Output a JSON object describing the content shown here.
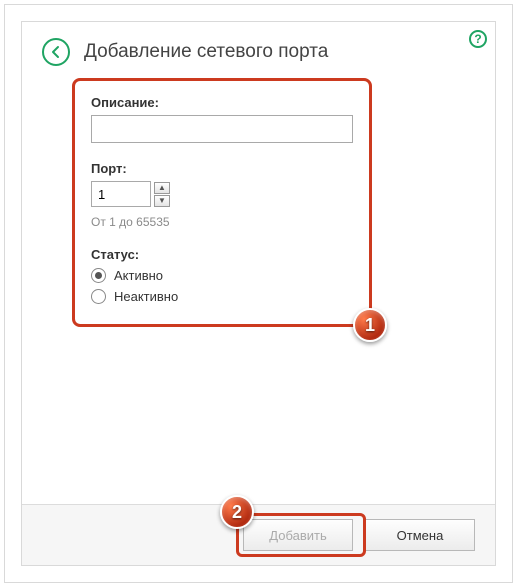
{
  "header": {
    "title": "Добавление сетевого порта"
  },
  "form": {
    "description_label": "Описание:",
    "description_value": "",
    "port_label": "Порт:",
    "port_value": "1",
    "port_hint": "От 1 до 65535",
    "status_label": "Статус:",
    "status_options": {
      "active": "Активно",
      "inactive": "Неактивно"
    },
    "status_selected": "active"
  },
  "footer": {
    "add_label": "Добавить",
    "cancel_label": "Отмена"
  },
  "callouts": {
    "one": "1",
    "two": "2"
  }
}
